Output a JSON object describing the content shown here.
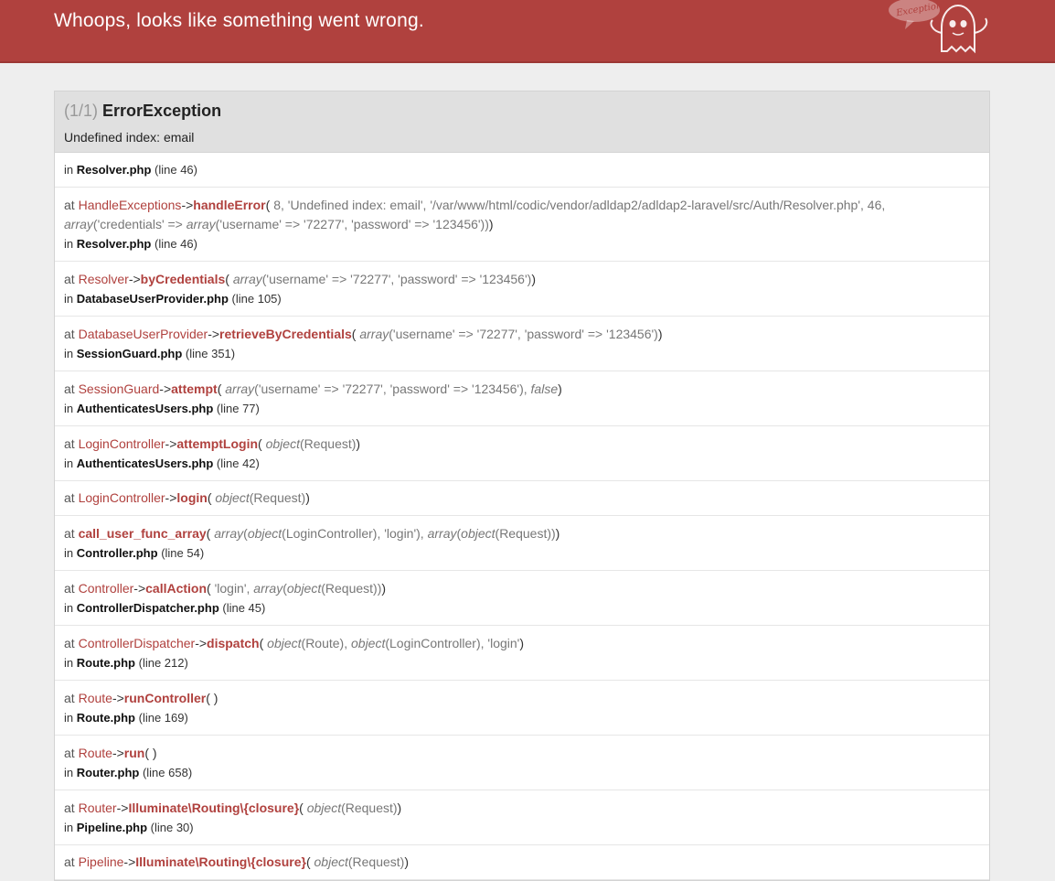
{
  "header": {
    "title": "Whoops, looks like something went wrong.",
    "mascot_text": "Exception!",
    "mascot_icon": "ghost-icon",
    "bg_color": "#b0413e"
  },
  "exception": {
    "count": "(1/1)",
    "type": "ErrorException",
    "message": "Undefined index: email",
    "origin_prefix": "in",
    "origin_file": "Resolver.php",
    "origin_line": "(line 46)"
  },
  "frames": [
    {
      "cls": "HandleExceptions",
      "fn": "handleError",
      "args_html": "8, 'Undefined index: email', '/var/www/html/codic/vendor/adldap2/adldap2-laravel/src/Auth/Resolver.php', 46,<br><i>array</i>('credentials' => <i>array</i>('username' => '72277', 'password' => '123456'))",
      "file": "Resolver.php",
      "line": "(line 46)"
    },
    {
      "cls": "Resolver",
      "fn": "byCredentials",
      "args_html": "<i>array</i>('username' => '72277', 'password' => '123456')",
      "file": "DatabaseUserProvider.php",
      "line": "(line 105)"
    },
    {
      "cls": "DatabaseUserProvider",
      "fn": "retrieveByCredentials",
      "args_html": "<i>array</i>('username' => '72277', 'password' => '123456')",
      "file": "SessionGuard.php",
      "line": "(line 351)"
    },
    {
      "cls": "SessionGuard",
      "fn": "attempt",
      "args_html": "<i>array</i>('username' => '72277', 'password' => '123456'), <i>false</i>",
      "file": "AuthenticatesUsers.php",
      "line": "(line 77)"
    },
    {
      "cls": "LoginController",
      "fn": "attemptLogin",
      "args_html": "<i>object</i>(Request)",
      "file": "AuthenticatesUsers.php",
      "line": "(line 42)"
    },
    {
      "cls": "LoginController",
      "fn": "login",
      "args_html": "<i>object</i>(Request)",
      "file": "",
      "line": ""
    },
    {
      "cls": "",
      "fn": "call_user_func_array",
      "args_html": "<i>array</i>(<i>object</i>(LoginController), 'login'), <i>array</i>(<i>object</i>(Request))",
      "file": "Controller.php",
      "line": "(line 54)"
    },
    {
      "cls": "Controller",
      "fn": "callAction",
      "args_html": "'login', <i>array</i>(<i>object</i>(Request))",
      "file": "ControllerDispatcher.php",
      "line": "(line 45)"
    },
    {
      "cls": "ControllerDispatcher",
      "fn": "dispatch",
      "args_html": "<i>object</i>(Route), <i>object</i>(LoginController), 'login'",
      "file": "Route.php",
      "line": "(line 212)"
    },
    {
      "cls": "Route",
      "fn": "runController",
      "args_html": "",
      "file": "Route.php",
      "line": "(line 169)"
    },
    {
      "cls": "Route",
      "fn": "run",
      "args_html": "",
      "file": "Router.php",
      "line": "(line 658)"
    },
    {
      "cls": "Router",
      "fn": "Illuminate\\Routing\\{closure}",
      "args_html": "<i>object</i>(Request)",
      "file": "Pipeline.php",
      "line": "(line 30)"
    },
    {
      "cls": "Pipeline",
      "fn": "Illuminate\\Routing\\{closure}",
      "args_html": "<i>object</i>(Request)",
      "file": "",
      "line": ""
    }
  ],
  "labels": {
    "at": "at",
    "in": "in",
    "arrow": "->"
  },
  "colors": {
    "accent": "#b0413e",
    "panel_header": "#e0e0e0",
    "page_bg": "#eeeeee"
  }
}
